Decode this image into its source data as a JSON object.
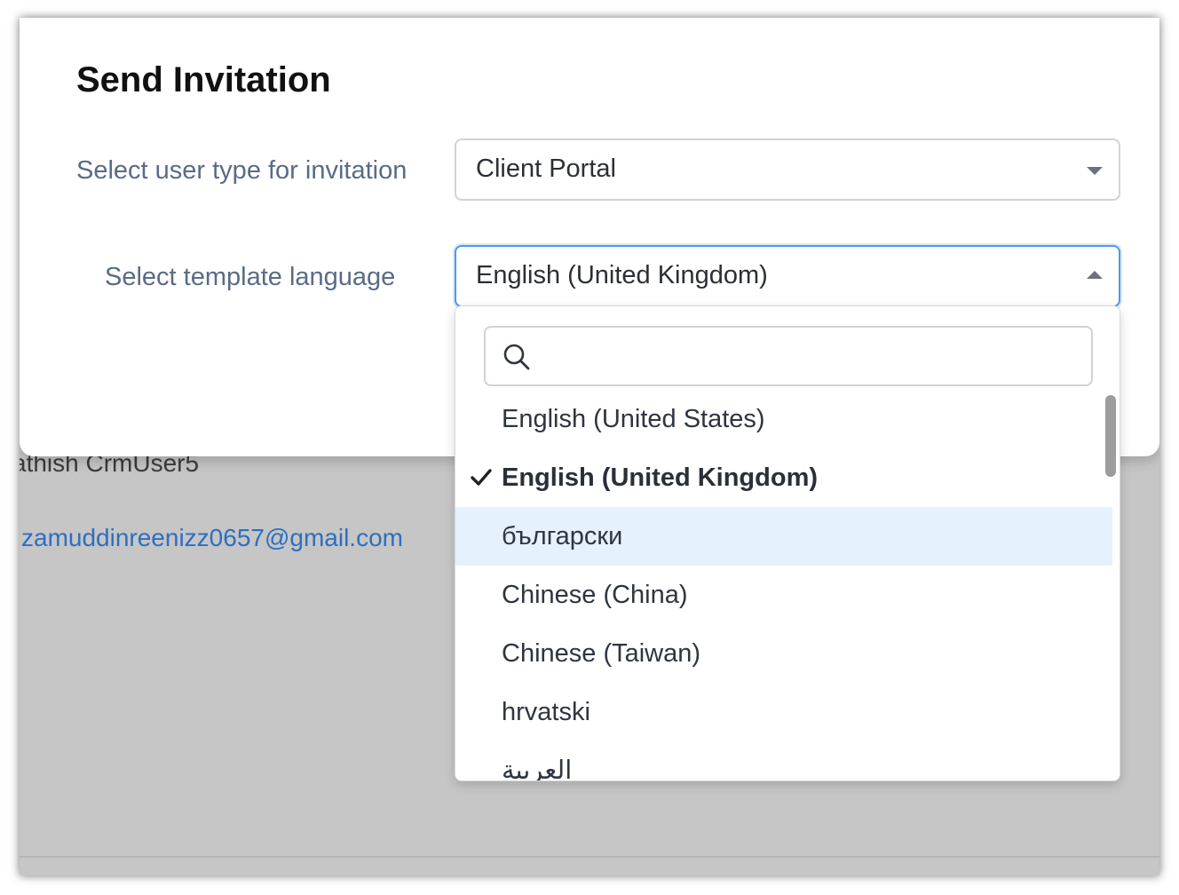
{
  "dialog": {
    "title": "Send Invitation",
    "user_type_label": "Select user type for invitation",
    "user_type_value": "Client Portal",
    "language_label": "Select template language",
    "language_value": "English (United Kingdom)"
  },
  "language_dropdown": {
    "search_placeholder": "",
    "options": [
      {
        "label": "English (United States)",
        "state": "normal"
      },
      {
        "label": "English (United Kingdom)",
        "state": "selected"
      },
      {
        "label": "български",
        "state": "hovered"
      },
      {
        "label": "Chinese (China)",
        "state": "normal"
      },
      {
        "label": "Chinese (Taiwan)",
        "state": "normal"
      },
      {
        "label": "hrvatski",
        "state": "normal"
      },
      {
        "label": "العربية",
        "state": "normal"
      }
    ]
  },
  "background": {
    "user_name": "athish CrmUser5",
    "email": "zamuddinreenizz0657@gmail.com"
  },
  "colors": {
    "focus_border": "#4d9ae8",
    "hover_row": "#e5f1fd",
    "label_text": "#5a6b87",
    "link_text": "#2d6fc0"
  }
}
